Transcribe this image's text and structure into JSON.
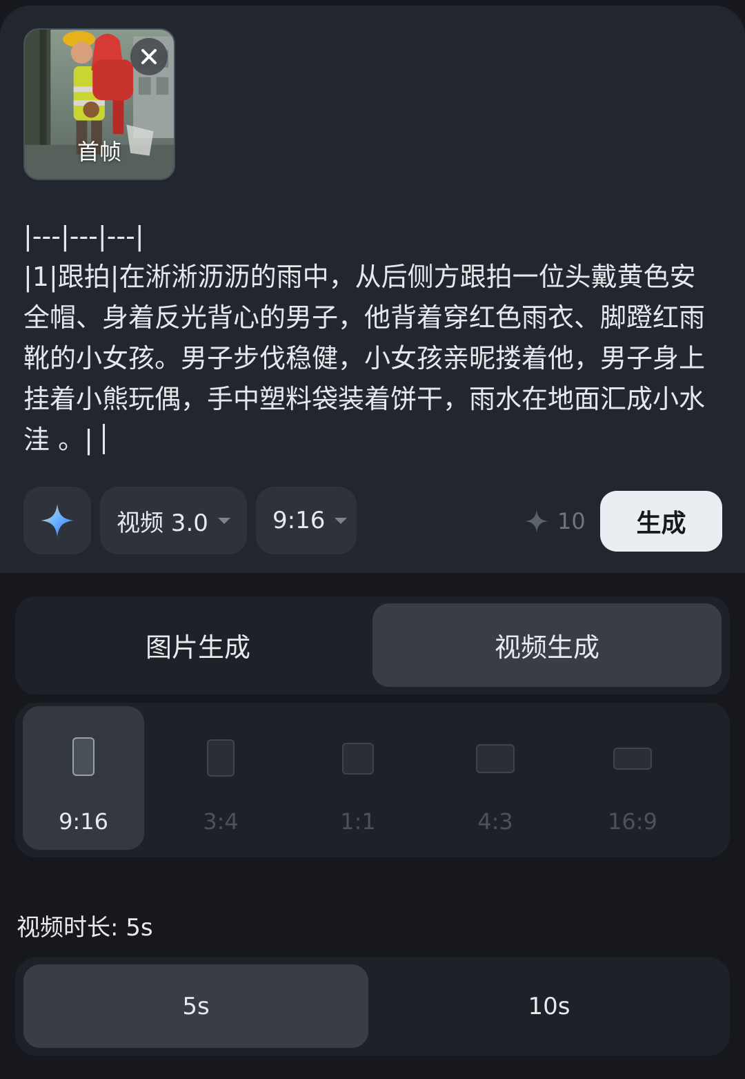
{
  "first_frame": {
    "label": "首帧",
    "image_alt": "man in yellow hard hat and reflective vest carrying a girl in red raincoat in the rain"
  },
  "prompt": {
    "text": "|---|---|---|\n|1|跟拍|在淅淅沥沥的雨中，从后侧方跟拍一位头戴黄色安全帽、身着反光背心的男子，他背着穿红色雨衣、脚蹬红雨靴的小女孩。男子步伐稳健，小女孩亲昵搂着他，男子身上挂着小熊玩偶，手中塑料袋装着饼干，雨水在地面汇成小水洼 。|"
  },
  "toolbar": {
    "model": "视频 3.0",
    "ratio": "9:16",
    "credits": "10",
    "generate": "生成"
  },
  "mode_tabs": {
    "image": "图片生成",
    "video": "视频生成",
    "selected": "video"
  },
  "ratios": [
    {
      "label": "9:16",
      "selected": true
    },
    {
      "label": "3:4",
      "selected": false
    },
    {
      "label": "1:1",
      "selected": false
    },
    {
      "label": "4:3",
      "selected": false
    },
    {
      "label": "16:9",
      "selected": false
    }
  ],
  "duration": {
    "label": "视频时长: 5s",
    "options": [
      {
        "label": "5s",
        "selected": true
      },
      {
        "label": "10s",
        "selected": false
      }
    ]
  },
  "colors": {
    "background": "#16181d",
    "card": "#22262e",
    "selected": "#383d46",
    "generate_button": "#e9eef3",
    "spark_blue": "#3d8bff"
  }
}
